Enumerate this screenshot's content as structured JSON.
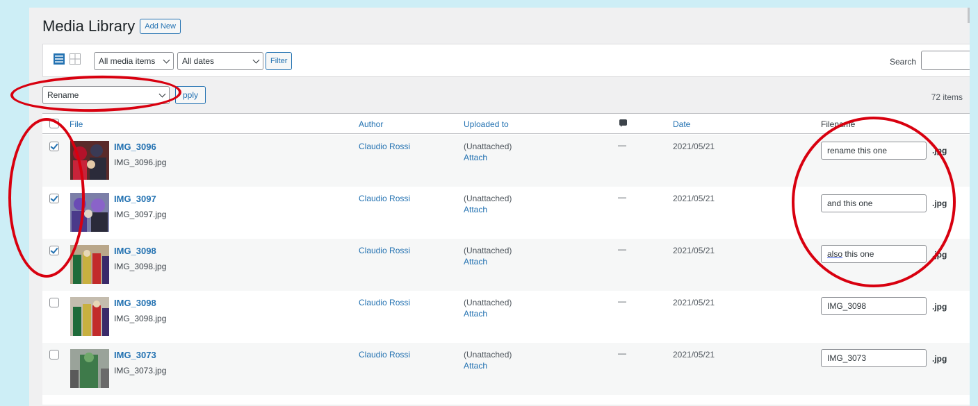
{
  "page": {
    "title": "Media Library",
    "add_new_label": "Add New"
  },
  "toolbar": {
    "view_list_icon": "list-view-icon",
    "view_grid_icon": "grid-view-icon",
    "media_filter": "All media items",
    "date_filter": "All dates",
    "filter_label": "Filter",
    "search_label": "Search",
    "search_value": ""
  },
  "bulk": {
    "action": "Rename",
    "apply_label": "pply",
    "items_count": "72 items"
  },
  "columns": {
    "file": "File",
    "author": "Author",
    "uploaded_to": "Uploaded to",
    "comments_icon": "comment-icon",
    "date": "Date",
    "filename": "Filename"
  },
  "rows": [
    {
      "checked": true,
      "title": "IMG_3096",
      "filename": "IMG_3096.jpg",
      "author": "Claudio Rossi",
      "uploaded": "(Unattached)",
      "attach": "Attach",
      "comments": "—",
      "date": "2021/05/21",
      "new_name": "rename this one",
      "ext": ".jpg"
    },
    {
      "checked": true,
      "title": "IMG_3097",
      "filename": "IMG_3097.jpg",
      "author": "Claudio Rossi",
      "uploaded": "(Unattached)",
      "attach": "Attach",
      "comments": "—",
      "date": "2021/05/21",
      "new_name": "and this one",
      "ext": ".jpg"
    },
    {
      "checked": true,
      "title": "IMG_3098",
      "filename": "IMG_3098.jpg",
      "author": "Claudio Rossi",
      "uploaded": "(Unattached)",
      "attach": "Attach",
      "comments": "—",
      "date": "2021/05/21",
      "new_name_prefix": "also",
      "new_name_rest": " this one",
      "ext": ".jpg"
    },
    {
      "checked": false,
      "title": "IMG_3098",
      "filename": "IMG_3098.jpg",
      "author": "Claudio Rossi",
      "uploaded": "(Unattached)",
      "attach": "Attach",
      "comments": "—",
      "date": "2021/05/21",
      "new_name": "IMG_3098",
      "ext": ".jpg"
    },
    {
      "checked": false,
      "title": "IMG_3073",
      "filename": "IMG_3073.jpg",
      "author": "Claudio Rossi",
      "uploaded": "(Unattached)",
      "attach": "Attach",
      "comments": "—",
      "date": "2021/05/21",
      "new_name": "IMG_3073",
      "ext": ".jpg"
    }
  ],
  "colors": {
    "accent": "#2271b1",
    "annotation": "#d8000f",
    "background": "#cdeef6"
  }
}
